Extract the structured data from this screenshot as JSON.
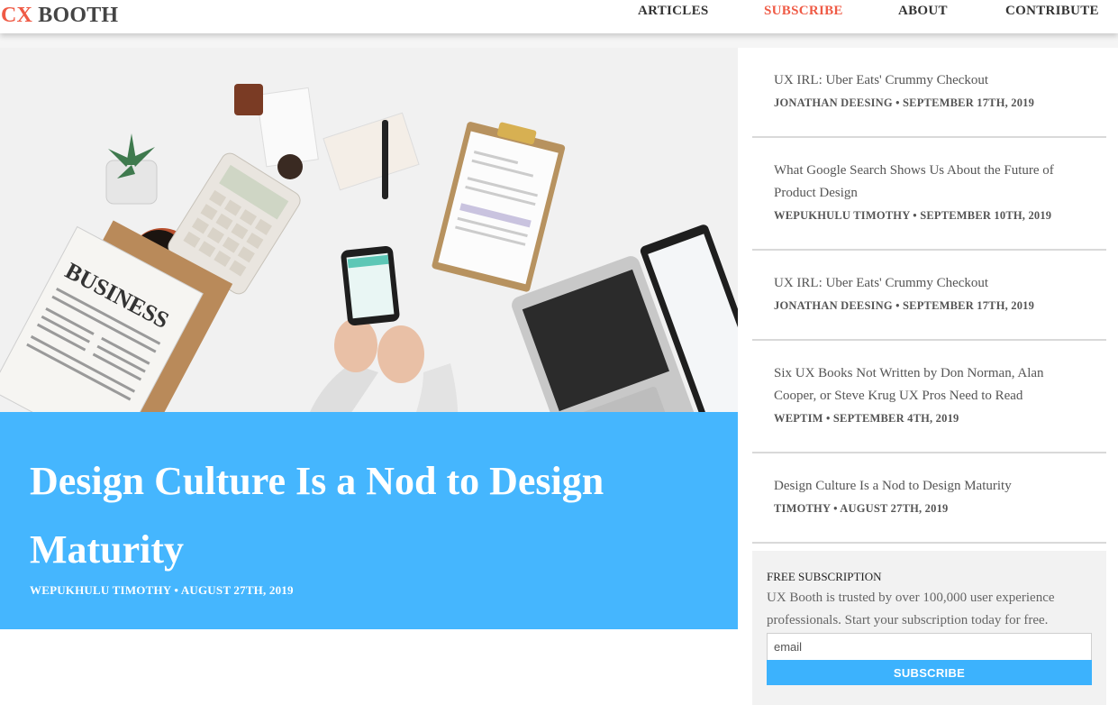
{
  "brand": {
    "cx": "CX",
    "booth": "BOOTH"
  },
  "nav": {
    "articles": "ARTICLES",
    "subscribe": "SUBSCRIBE",
    "about": "ABOUT",
    "contribute": "CONTRIBUTE"
  },
  "hero": {
    "title": "Design Culture Is a Nod to Design Maturity",
    "meta": "WEPUKHULU TIMOTHY • AUGUST 27TH, 2019",
    "image_text": {
      "newspaper": "BUSINESS"
    }
  },
  "sidebar": {
    "items": [
      {
        "title": "UX IRL: Uber Eats' Crummy Checkout",
        "meta": "JONATHAN DEESING • SEPTEMBER 17TH, 2019"
      },
      {
        "title": "What Google Search Shows Us About the Future of Product Design",
        "meta": "WEPUKHULU TIMOTHY • SEPTEMBER 10TH, 2019"
      },
      {
        "title": "UX IRL: Uber Eats' Crummy Checkout",
        "meta": "JONATHAN DEESING • SEPTEMBER 17TH, 2019"
      },
      {
        "title": "Six UX Books Not Written by Don Norman, Alan Cooper, or Steve Krug UX Pros Need to Read",
        "meta": "WEPTIM • SEPTEMBER 4TH, 2019"
      },
      {
        "title": "Design Culture Is a Nod to Design Maturity",
        "meta": "TIMOTHY • AUGUST 27TH, 2019"
      }
    ]
  },
  "subscription": {
    "heading": "FREE SUBSCRIPTION",
    "text": "UX Booth is trusted by over 100,000 user experience professionals. Start your subscription today for free.",
    "placeholder": "email",
    "button": "SUBSCRIBE"
  },
  "colors": {
    "accent": "#ef5a45",
    "hero_blue": "#45b6fe",
    "button_blue": "#3cb2fd"
  }
}
